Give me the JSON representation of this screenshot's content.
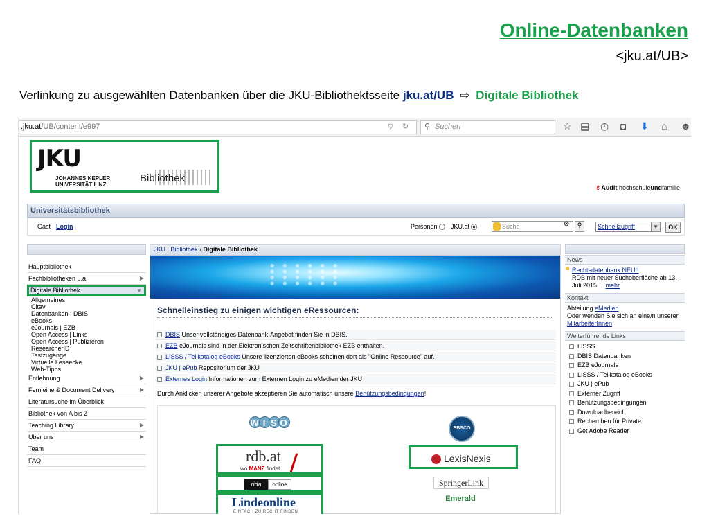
{
  "slide": {
    "title": "Online-Datenbanken",
    "subtitle": "<jku.at/UB>",
    "intro_text": "Verlinkung zu ausgewählten Datenbanken über die JKU-Bibliothektsseite",
    "intro_link": "jku.at/UB",
    "intro_arrow": "⇨",
    "intro_target": "Digitale Bibliothek"
  },
  "browser": {
    "url_host": ".jku.at",
    "url_path": "/UB/content/e997",
    "search_placeholder": "Suchen"
  },
  "header": {
    "logo_text": "JKU",
    "logo_sub1": "JOHANNES KEPLER",
    "logo_sub2": "UNIVERSITÄT LINZ",
    "bibliothek_label": "Bibliothek",
    "audit_brand": "Audit",
    "audit_text": "hochschule",
    "audit_text_bold": "und",
    "audit_text_end": "familie",
    "ub_title": "Universitätsbibliothek",
    "gast": "Gast",
    "login": "Login",
    "personen": "Personen",
    "jku_at": "JKU.at",
    "search_placeholder": "Suche",
    "quick_access": "Schnellzugriff",
    "ok": "OK"
  },
  "nav": {
    "items": [
      {
        "label": "Hauptbibliothek",
        "chevron": false
      },
      {
        "label": "Fachbibliotheken u.a.",
        "chevron": true
      },
      {
        "label": "Digitale Bibliothek",
        "chevron": true
      }
    ],
    "subitems": [
      "Allgemeines",
      "Citavi",
      "Datenbanken : DBIS",
      "eBooks",
      "eJournals | EZB",
      "Open Access | Links",
      "Open Access | Publizieren",
      "ResearcherID",
      "Testzugänge",
      "Virtuelle Leseecke",
      "Web-Tipps"
    ],
    "more_items": [
      {
        "label": "Entlehnung",
        "chevron": true
      },
      {
        "label": "Fernleihe & Document Delivery",
        "chevron": true
      },
      {
        "label": "Literatursuche im Überblick",
        "chevron": false
      },
      {
        "label": "Bibliothek von A bis Z",
        "chevron": false
      },
      {
        "label": "Teaching Library",
        "chevron": true
      },
      {
        "label": "Über uns",
        "chevron": true
      },
      {
        "label": "Team",
        "chevron": false
      },
      {
        "label": "FAQ",
        "chevron": false
      }
    ]
  },
  "main": {
    "breadcrumb": [
      "JKU",
      "Bibliothek",
      "Digitale Bibliothek"
    ],
    "section_title": "Schnelleinstieg zu einigen wichtigen eRessourcen:",
    "resources": [
      {
        "link": "DBIS",
        "text": " Unser vollständiges Datenbank-Angebot finden Sie in DBIS."
      },
      {
        "link": "EZB",
        "text": " eJournals sind in der Elektronischen Zeitschriftenbibliothek EZB enthalten."
      },
      {
        "link": "LISSS / Teilkatalog eBooks",
        "text": " Unsere lizenzierten eBooks scheinen dort als \"Online Ressource\" auf."
      },
      {
        "link": "JKU | ePub",
        "text": " Repositorium der JKU"
      },
      {
        "link": "Externes Login",
        "text": " Informationen zum Externen Login zu eMedien der JKU"
      }
    ],
    "terms_text": "Durch Anklicken unserer Angebote akzeptieren Sie automatisch unsere",
    "terms_link": "Benützungsbedingungen",
    "terms_end": "!",
    "logos": {
      "wiso": [
        "W",
        "I",
        "S",
        "O"
      ],
      "ebsco": "EBSCO",
      "rdb_title": "rdb.at",
      "rdb_tag_pre": "wo ",
      "rdb_tag_brand": "MANZ",
      "rdb_tag_post": " findet",
      "rida_a": "rida",
      "rida_b": "online",
      "linde_title": "Lindeonline",
      "linde_tag": "EINFACH ZU RECHT FINDEN",
      "lexis": "LexisNexis",
      "springer": "SpringerLink",
      "emerald": "Emerald"
    }
  },
  "right": {
    "news_title": "News",
    "news_link": "Rechtsdatenbank NEU!!",
    "news_text": "RDB mit neuer Suchoberfläche ab 13. Juli 2015 ...",
    "news_more": "mehr",
    "contact_title": "Kontakt",
    "contact_pre": "Abteilung ",
    "contact_link": "eMedien",
    "contact_text": "Oder wenden Sie sich an eine/n unserer",
    "contact_link2": "MitarbeiterInnen",
    "links_title": "Weiterführende Links",
    "links": [
      "LISSS",
      "DBIS Datenbanken",
      "EZB eJournals",
      "LISSS / Teilkatalog eBooks",
      "JKU | ePub",
      "Externer Zugriff",
      "Benützungsbedingungen",
      "Downloadbereich",
      "Recherchen für Private",
      "Get Adobe Reader"
    ]
  },
  "colors": {
    "accent_green": "#1aa04a",
    "link_blue": "#0a2a8a"
  }
}
